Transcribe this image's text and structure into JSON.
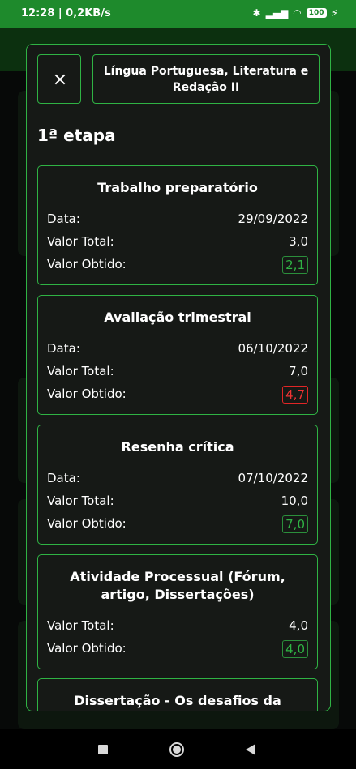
{
  "status_bar": {
    "time": "12:28 | 0,2KB/s",
    "battery": "100"
  },
  "modal": {
    "title": "Língua Portuguesa, Literatura e Redação  II",
    "stage": "1ª etapa",
    "items": [
      {
        "title": "Trabalho preparatório",
        "date_label": "Data:",
        "date": "29/09/2022",
        "total_label": "Valor Total:",
        "total": "3,0",
        "obtained_label": "Valor Obtido:",
        "obtained": "2,1"
      },
      {
        "title": "Avaliação trimestral",
        "date_label": "Data:",
        "date": "06/10/2022",
        "total_label": "Valor Total:",
        "total": "7,0",
        "obtained_label": "Valor Obtido:",
        "obtained": "4,7"
      },
      {
        "title": "Resenha crítica",
        "date_label": "Data:",
        "date": "07/10/2022",
        "total_label": "Valor Total:",
        "total": "10,0",
        "obtained_label": "Valor Obtido:",
        "obtained": "7,0"
      },
      {
        "title": "Atividade Processual (Fórum, artigo, Dissertações)",
        "total_label": "Valor Total:",
        "total": "4,0",
        "obtained_label": "Valor Obtido:",
        "obtained": "4,0"
      },
      {
        "title": "Dissertação - Os desafios da"
      }
    ]
  },
  "colors": {
    "accent": "#2fb344",
    "danger": "#ef3434",
    "status_bar": "#1e8a2c"
  }
}
